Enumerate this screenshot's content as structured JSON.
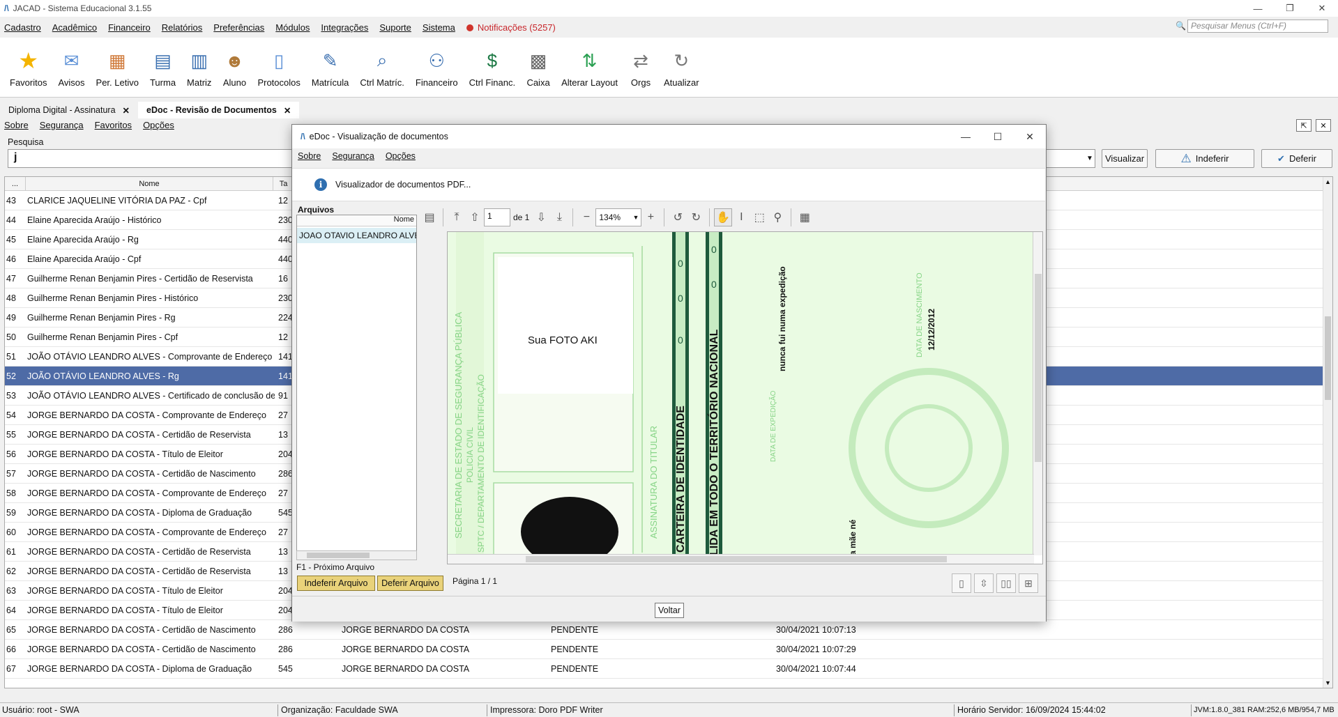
{
  "window": {
    "title": "JACAD - Sistema Educacional 3.1.55",
    "controls": [
      "—",
      "❐",
      "✕"
    ]
  },
  "menubar": {
    "items": [
      "Cadastro",
      "Acadêmico",
      "Financeiro",
      "Relatórios",
      "Preferências",
      "Módulos",
      "Integrações",
      "Suporte",
      "Sistema"
    ],
    "notifications": "Notificações (5257)",
    "search_placeholder": "Pesquisar Menus (Ctrl+F)"
  },
  "toolbar": {
    "items": [
      {
        "label": "Favoritos",
        "icon": "star-icon"
      },
      {
        "label": "Avisos",
        "icon": "envelope-icon"
      },
      {
        "label": "Per. Letivo",
        "icon": "calendar-icon"
      },
      {
        "label": "Turma",
        "icon": "class-icon"
      },
      {
        "label": "Matriz",
        "icon": "matrix-icon"
      },
      {
        "label": "Aluno",
        "icon": "student-icon"
      },
      {
        "label": "Protocolos",
        "icon": "protocol-icon"
      },
      {
        "label": "Matrícula",
        "icon": "enrollment-icon"
      },
      {
        "label": "Ctrl Matríc.",
        "icon": "enrollment-control-icon"
      },
      {
        "label": "Financeiro",
        "icon": "finance-icon"
      },
      {
        "label": "Ctrl Financ.",
        "icon": "finance-control-icon"
      },
      {
        "label": "Caixa",
        "icon": "cash-register-icon"
      },
      {
        "label": "Alterar Layout",
        "icon": "layout-icon"
      },
      {
        "label": "Orgs",
        "icon": "orgs-icon"
      },
      {
        "label": "Atualizar",
        "icon": "refresh-icon"
      }
    ]
  },
  "tabs": [
    {
      "label": "Diploma Digital - Assinatura",
      "active": false
    },
    {
      "label": "eDoc - Revisão de Documentos",
      "active": true
    }
  ],
  "submenu": [
    "Sobre",
    "Segurança",
    "Favoritos",
    "Opções"
  ],
  "search": {
    "label": "Pesquisa",
    "value": "j",
    "buttons": {
      "visualizar": "Visualizar",
      "indeferir": "Indeferir",
      "deferir": "Deferir"
    }
  },
  "table": {
    "columns": [
      "...",
      "Nome",
      "Ta"
    ],
    "rows": [
      {
        "n": "43",
        "nome": "CLARICE JAQUELINE VITÓRIA DA PAZ - Cpf",
        "ta": "12"
      },
      {
        "n": "44",
        "nome": "Elaine Aparecida Araújo - Histórico",
        "ta": "230"
      },
      {
        "n": "45",
        "nome": "Elaine Aparecida Araújo - Rg",
        "ta": "440"
      },
      {
        "n": "46",
        "nome": "Elaine Aparecida Araújo - Cpf",
        "ta": "440"
      },
      {
        "n": "47",
        "nome": "Guilherme Renan Benjamin Pires - Certidão de Reservista",
        "ta": "16"
      },
      {
        "n": "48",
        "nome": "Guilherme Renan Benjamin Pires - Histórico",
        "ta": "230"
      },
      {
        "n": "49",
        "nome": "Guilherme Renan Benjamin Pires - Rg",
        "ta": "224"
      },
      {
        "n": "50",
        "nome": "Guilherme Renan Benjamin Pires - Cpf",
        "ta": "12"
      },
      {
        "n": "51",
        "nome": "JOÃO OTÁVIO LEANDRO ALVES - Comprovante de Endereço",
        "ta": "141"
      },
      {
        "n": "52",
        "nome": "JOÃO OTÁVIO LEANDRO ALVES - Rg",
        "ta": "141",
        "selected": true
      },
      {
        "n": "53",
        "nome": "JOÃO OTÁVIO LEANDRO ALVES - Certificado de conclusão de p...",
        "ta": "91"
      },
      {
        "n": "54",
        "nome": "JORGE BERNARDO DA COSTA - Comprovante de Endereço",
        "ta": "27"
      },
      {
        "n": "55",
        "nome": "JORGE BERNARDO DA COSTA - Certidão de Reservista",
        "ta": "13"
      },
      {
        "n": "56",
        "nome": "JORGE BERNARDO DA COSTA - Título de Eleitor",
        "ta": "204"
      },
      {
        "n": "57",
        "nome": "JORGE BERNARDO DA COSTA - Certidão de Nascimento",
        "ta": "286"
      },
      {
        "n": "58",
        "nome": "JORGE BERNARDO DA COSTA - Comprovante de Endereço",
        "ta": "27"
      },
      {
        "n": "59",
        "nome": "JORGE BERNARDO DA COSTA - Diploma de Graduação",
        "ta": "545"
      },
      {
        "n": "60",
        "nome": "JORGE BERNARDO DA COSTA - Comprovante de Endereço",
        "ta": "27"
      },
      {
        "n": "61",
        "nome": "JORGE BERNARDO DA COSTA - Certidão de Reservista",
        "ta": "13"
      },
      {
        "n": "62",
        "nome": "JORGE BERNARDO DA COSTA - Certidão de Reservista",
        "ta": "13"
      },
      {
        "n": "63",
        "nome": "JORGE BERNARDO DA COSTA - Título de Eleitor",
        "ta": "204"
      },
      {
        "n": "64",
        "nome": "JORGE BERNARDO DA COSTA - Título de Eleitor",
        "ta": "204"
      },
      {
        "n": "65",
        "nome": "JORGE BERNARDO DA COSTA - Certidão de Nascimento",
        "ta": "286",
        "aluno": "JORGE BERNARDO DA COSTA",
        "status": "PENDENTE",
        "data": "30/04/2021 10:07:13"
      },
      {
        "n": "66",
        "nome": "JORGE BERNARDO DA COSTA - Certidão de Nascimento",
        "ta": "286",
        "aluno": "JORGE BERNARDO DA COSTA",
        "status": "PENDENTE",
        "data": "30/04/2021 10:07:29"
      },
      {
        "n": "67",
        "nome": "JORGE BERNARDO DA COSTA - Diploma de Graduação",
        "ta": "545",
        "aluno": "JORGE BERNARDO DA COSTA",
        "status": "PENDENTE",
        "data": "30/04/2021 10:07:44"
      }
    ]
  },
  "statusbar": {
    "usuario": "Usuário: root - SWA",
    "organizacao": "Organização: Faculdade SWA",
    "impressora": "Impressora: Doro PDF Writer",
    "horario": "Horário Servidor: 16/09/2024 15:44:02",
    "jvm": "JVM:1.8.0_381  RAM:252,6 MB/954,7 MB"
  },
  "dialog": {
    "title": "eDoc - Visualização de documentos",
    "menu": [
      "Sobre",
      "Segurança",
      "Opções"
    ],
    "info": "Visualizador de documentos PDF...",
    "arquivos_label": "Arquivos",
    "arquivos_col": "Nome",
    "arquivo_item": "JOAO OTAVIO LEANDRO ALVES - Rg.pdf",
    "proximo": "F1 - Próximo Arquivo",
    "btn_indeferir": "Indeferir Arquivo",
    "btn_deferir": "Deferir Arquivo",
    "page_value": "1",
    "page_of": "de 1",
    "zoom": "134%",
    "pagina": "Página 1 / 1",
    "voltar": "Voltar"
  },
  "pdf": {
    "photo_text": "Sua FOTO AKI",
    "left_lines": [
      "SECRETARIA DE ESTADO DE SEGURANÇA PÚBLICA",
      "POLICIA CIVIL",
      "SPTC / DEPARTAMENTO DE IDENTIFICAÇÃO"
    ],
    "assinatura": "ASSINATURA DO TITULAR",
    "carteira": "CARTEIRA DE IDENTIDADE",
    "territorio": "LIDA EM TODO O TERRITÓRIO NACIONAL",
    "expedicao": "nunca fui numa expedição",
    "data_exp_label": "DATA DE EXPEDIÇÃO",
    "data_nasc_label": "DATA DE NASCIMENTO",
    "data_nasc": "12/12/2012",
    "mae": "a mãe né",
    "zeros": [
      "0",
      "0",
      "0",
      "0",
      "0"
    ],
    "colors": {
      "bg": "#eafbe3",
      "ink": "#7ccf7c",
      "stripe": "#1e5a3c"
    }
  }
}
